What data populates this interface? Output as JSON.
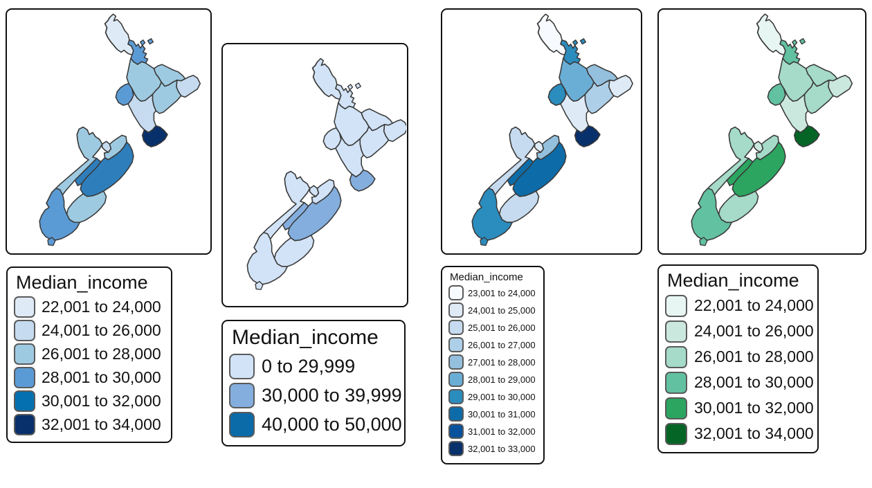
{
  "chart_data": {
    "type": "map",
    "title": "Median_income",
    "description": "Four choropleth maps of New Zealand regions shaded by Median_income, each with its own classification scheme and color ramp.",
    "panels": [
      {
        "id": "panel-1",
        "legend_title": "Median_income",
        "palette": "Blues",
        "classes": [
          {
            "label": "22,001 to 24,000",
            "color": "#deebf7"
          },
          {
            "label": "24,001 to 26,000",
            "color": "#c6dbef"
          },
          {
            "label": "26,001 to 28,000",
            "color": "#9ecae1"
          },
          {
            "label": "28,001 to 30,000",
            "color": "#5b9bd5"
          },
          {
            "label": "30,001 to 32,000",
            "color": "#0570b0"
          },
          {
            "label": "32,001 to 34,000",
            "color": "#08306b"
          }
        ],
        "regions": [
          {
            "name": "Northland",
            "class": 0,
            "color": "#deebf7"
          },
          {
            "name": "Auckland",
            "class": 3,
            "color": "#5b9bd5"
          },
          {
            "name": "Waikato",
            "class": 2,
            "color": "#9ecae1"
          },
          {
            "name": "Bay of Plenty",
            "class": 2,
            "color": "#9ecae1"
          },
          {
            "name": "Gisborne",
            "class": 1,
            "color": "#c6dbef"
          },
          {
            "name": "Taranaki",
            "class": 3,
            "color": "#5b9bd5"
          },
          {
            "name": "Hawke's Bay",
            "class": 2,
            "color": "#9ecae1"
          },
          {
            "name": "Manawatu-Wanganui",
            "class": 1,
            "color": "#c6dbef"
          },
          {
            "name": "Wellington",
            "class": 5,
            "color": "#08306b"
          },
          {
            "name": "Tasman",
            "class": 2,
            "color": "#9ecae1"
          },
          {
            "name": "Nelson",
            "class": 1,
            "color": "#c6dbef"
          },
          {
            "name": "Marlborough",
            "class": 2,
            "color": "#9ecae1"
          },
          {
            "name": "West Coast",
            "class": 2,
            "color": "#9ecae1"
          },
          {
            "name": "Canterbury",
            "class": 4,
            "color": "#2e7ebb"
          },
          {
            "name": "Otago",
            "class": 2,
            "color": "#9ecae1"
          },
          {
            "name": "Southland",
            "class": 3,
            "color": "#5b9bd5"
          }
        ]
      },
      {
        "id": "panel-2",
        "legend_title": "Median_income",
        "palette": "Blues",
        "classes": [
          {
            "label": "0 to 29,999",
            "color": "#d2e3f7"
          },
          {
            "label": "30,000 to 39,999",
            "color": "#84aede"
          },
          {
            "label": "40,000 to 50,000",
            "color": "#0b6aa8"
          }
        ],
        "regions": [
          {
            "name": "Northland",
            "class": 0,
            "color": "#d2e3f7"
          },
          {
            "name": "Auckland",
            "class": 0,
            "color": "#d2e3f7"
          },
          {
            "name": "Waikato",
            "class": 0,
            "color": "#d2e3f7"
          },
          {
            "name": "Bay of Plenty",
            "class": 0,
            "color": "#d2e3f7"
          },
          {
            "name": "Gisborne",
            "class": 0,
            "color": "#d2e3f7"
          },
          {
            "name": "Taranaki",
            "class": 0,
            "color": "#d2e3f7"
          },
          {
            "name": "Hawke's Bay",
            "class": 0,
            "color": "#d2e3f7"
          },
          {
            "name": "Manawatu-Wanganui",
            "class": 0,
            "color": "#d2e3f7"
          },
          {
            "name": "Wellington",
            "class": 1,
            "color": "#84aede"
          },
          {
            "name": "Tasman",
            "class": 0,
            "color": "#d2e3f7"
          },
          {
            "name": "Nelson",
            "class": 0,
            "color": "#d2e3f7"
          },
          {
            "name": "Marlborough",
            "class": 0,
            "color": "#d2e3f7"
          },
          {
            "name": "West Coast",
            "class": 0,
            "color": "#d2e3f7"
          },
          {
            "name": "Canterbury",
            "class": 1,
            "color": "#84aede"
          },
          {
            "name": "Otago",
            "class": 0,
            "color": "#d2e3f7"
          },
          {
            "name": "Southland",
            "class": 0,
            "color": "#d2e3f7"
          }
        ]
      },
      {
        "id": "panel-3",
        "legend_title": "Median_income",
        "palette": "Blues",
        "classes": [
          {
            "label": "23,001 to 24,000",
            "color": "#f7fbff"
          },
          {
            "label": "24,001 to 25,000",
            "color": "#deebf7"
          },
          {
            "label": "25,001 to 26,000",
            "color": "#c6dbef"
          },
          {
            "label": "26,001 to 27,000",
            "color": "#aecfe8"
          },
          {
            "label": "27,001 to 28,000",
            "color": "#94c0dd"
          },
          {
            "label": "28,001 to 29,000",
            "color": "#6aaed6"
          },
          {
            "label": "29,001 to 30,000",
            "color": "#2b8cbe"
          },
          {
            "label": "30,001 to 31,000",
            "color": "#0d6ca8"
          },
          {
            "label": "31,001 to 32,000",
            "color": "#08519c"
          },
          {
            "label": "32,001 to 33,000",
            "color": "#08306b"
          }
        ],
        "regions": [
          {
            "name": "Northland",
            "class": 0,
            "color": "#f7fbff"
          },
          {
            "name": "Auckland",
            "class": 6,
            "color": "#2b8cbe"
          },
          {
            "name": "Waikato",
            "class": 5,
            "color": "#6aaed6"
          },
          {
            "name": "Bay of Plenty",
            "class": 4,
            "color": "#94c0dd"
          },
          {
            "name": "Gisborne",
            "class": 1,
            "color": "#deebf7"
          },
          {
            "name": "Taranaki",
            "class": 6,
            "color": "#2b8cbe"
          },
          {
            "name": "Hawke's Bay",
            "class": 3,
            "color": "#aecfe8"
          },
          {
            "name": "Manawatu-Wanganui",
            "class": 1,
            "color": "#deebf7"
          },
          {
            "name": "Wellington",
            "class": 9,
            "color": "#08306b"
          },
          {
            "name": "Tasman",
            "class": 3,
            "color": "#aecfe8"
          },
          {
            "name": "Nelson",
            "class": 1,
            "color": "#deebf7"
          },
          {
            "name": "Marlborough",
            "class": 4,
            "color": "#94c0dd"
          },
          {
            "name": "West Coast",
            "class": 2,
            "color": "#c6dbef"
          },
          {
            "name": "Canterbury",
            "class": 7,
            "color": "#0d6ca8"
          },
          {
            "name": "Otago",
            "class": 2,
            "color": "#c6dbef"
          },
          {
            "name": "Southland",
            "class": 6,
            "color": "#2b8cbe"
          }
        ]
      },
      {
        "id": "panel-4",
        "legend_title": "Median_income",
        "palette": "Greens",
        "classes": [
          {
            "label": "22,001 to 24,000",
            "color": "#e8f6f3"
          },
          {
            "label": "24,001 to 26,000",
            "color": "#cbe8de"
          },
          {
            "label": "26,001 to 28,000",
            "color": "#a5dbc8"
          },
          {
            "label": "28,001 to 30,000",
            "color": "#62c1a0"
          },
          {
            "label": "30,001 to 32,000",
            "color": "#2ba560"
          },
          {
            "label": "32,001 to 34,000",
            "color": "#056526"
          }
        ],
        "regions": [
          {
            "name": "Northland",
            "class": 0,
            "color": "#e8f6f3"
          },
          {
            "name": "Auckland",
            "class": 3,
            "color": "#62c1a0"
          },
          {
            "name": "Waikato",
            "class": 2,
            "color": "#a5dbc8"
          },
          {
            "name": "Bay of Plenty",
            "class": 2,
            "color": "#a5dbc8"
          },
          {
            "name": "Gisborne",
            "class": 1,
            "color": "#cbe8de"
          },
          {
            "name": "Taranaki",
            "class": 3,
            "color": "#62c1a0"
          },
          {
            "name": "Hawke's Bay",
            "class": 2,
            "color": "#a5dbc8"
          },
          {
            "name": "Manawatu-Wanganui",
            "class": 1,
            "color": "#cbe8de"
          },
          {
            "name": "Wellington",
            "class": 5,
            "color": "#056526"
          },
          {
            "name": "Tasman",
            "class": 2,
            "color": "#a5dbc8"
          },
          {
            "name": "Nelson",
            "class": 1,
            "color": "#cbe8de"
          },
          {
            "name": "Marlborough",
            "class": 2,
            "color": "#a5dbc8"
          },
          {
            "name": "West Coast",
            "class": 2,
            "color": "#a5dbc8"
          },
          {
            "name": "Canterbury",
            "class": 4,
            "color": "#2ba560"
          },
          {
            "name": "Otago",
            "class": 2,
            "color": "#a5dbc8"
          },
          {
            "name": "Southland",
            "class": 3,
            "color": "#62c1a0"
          }
        ]
      }
    ]
  },
  "panels": {
    "p1": {
      "legend_title": "Median_income",
      "labels": [
        "22,001 to 24,000",
        "24,001 to 26,000",
        "26,001 to 28,000",
        "28,001 to 30,000",
        "30,001 to 32,000",
        "32,001 to 34,000"
      ]
    },
    "p2": {
      "legend_title": "Median_income",
      "labels": [
        "0 to 29,999",
        "30,000 to 39,999",
        "40,000 to 50,000"
      ]
    },
    "p3": {
      "legend_title": "Median_income",
      "labels": [
        "23,001 to 24,000",
        "24,001 to 25,000",
        "25,001 to 26,000",
        "26,001 to 27,000",
        "27,001 to 28,000",
        "28,001 to 29,000",
        "29,001 to 30,000",
        "30,001 to 31,000",
        "31,001 to 32,000",
        "32,001 to 33,000"
      ]
    },
    "p4": {
      "legend_title": "Median_income",
      "labels": [
        "22,001 to 24,000",
        "24,001 to 26,000",
        "26,001 to 28,000",
        "28,001 to 30,000",
        "30,001 to 32,000",
        "32,001 to 34,000"
      ]
    }
  }
}
